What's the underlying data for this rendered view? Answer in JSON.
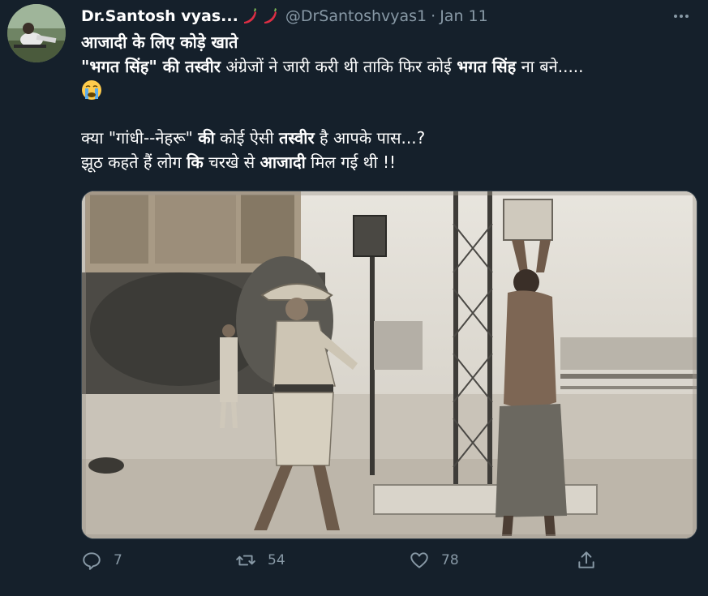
{
  "tweet": {
    "author_name": "Dr.Santosh vyas...",
    "author_emoji": [
      "hot-pepper-icon",
      "hot-pepper-icon"
    ],
    "handle": "@DrSantoshvyas1",
    "separator": "·",
    "time": "Jan 11",
    "lines": {
      "l1": "आजादी के लिए कोड़े खाते",
      "l2a": "\"भगत सिंह\"",
      "l2b": " की तस्वीर",
      "l2c": " अंग्रेजों ने जारी करी थी ताकि फिर कोई ",
      "l2d": "भगत सिंह",
      "l2e": " ना बने.....",
      "l3a": "क्या \"गांधी--नेहरू\" ",
      "l3b": "की",
      "l3c": " कोई ऐसी ",
      "l3d": "तस्वीर",
      "l3e": " है आपके पास...?",
      "l4a": "झूठ कहते हैं लोग ",
      "l4b": "कि",
      "l4c": " चरखे से ",
      "l4d": "आजादी",
      "l4e": " मिल गई थी !!"
    },
    "crying_emoji": "loudly-crying-face-icon"
  },
  "actions": {
    "reply_count": "7",
    "retweet_count": "54",
    "like_count": "78"
  },
  "colors": {
    "background": "#15202b",
    "secondary_text": "#8899a6",
    "border": "#38444d"
  }
}
